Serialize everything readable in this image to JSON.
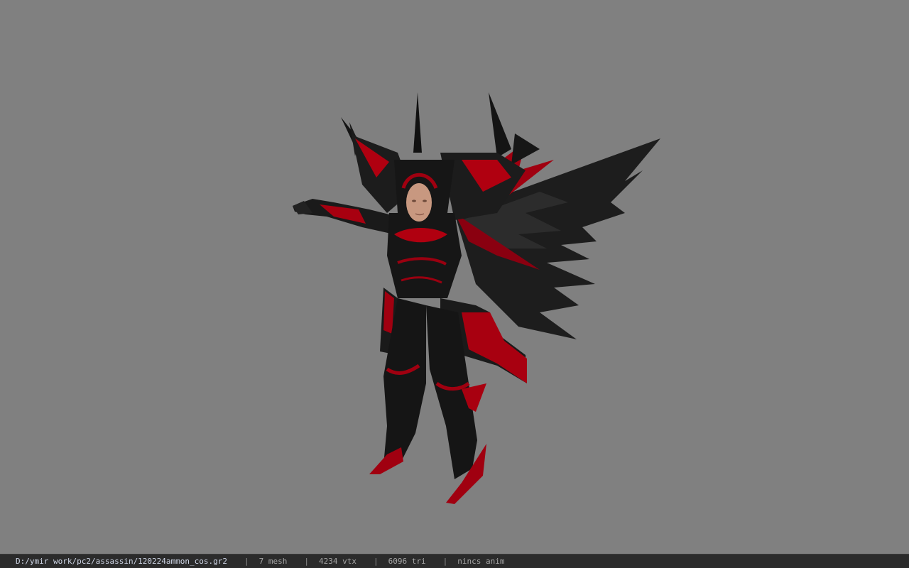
{
  "viewport": {
    "background": "#808080",
    "model": {
      "icon": "armored-character-model",
      "armor_color": "#1a1a1a",
      "accent_color": "#b00010",
      "skin_color": "#c89880"
    }
  },
  "statusbar": {
    "file_path": "D:/ymir work/pc2/assassin/120224ammon_cos.gr2",
    "separator": "|",
    "mesh": "7 mesh",
    "vtx": "4234 vtx",
    "tri": "6096 tri",
    "anim": "nincs anim"
  }
}
